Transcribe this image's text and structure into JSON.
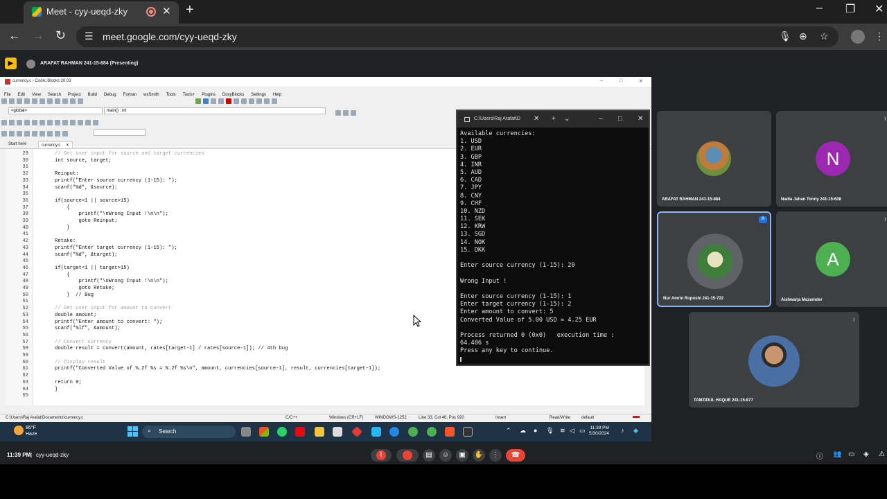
{
  "browser": {
    "tab_title": "Meet - cyy-ueqd-zky",
    "url": "meet.google.com/cyy-ueqd-zky"
  },
  "meet": {
    "presenting_label": "ARAFAT RAHMAN 241-15-884 (Presenting)",
    "meeting_time": "11:39 PM",
    "meeting_code": "cyy-ueqd-zky",
    "participants": [
      {
        "name": "ARAFAT RAHMAN 241-15-884",
        "type": "photo"
      },
      {
        "name": "Nadia Jahan Tonny 241-15-608",
        "type": "initial",
        "initial": "N",
        "color": "#9c27b0"
      },
      {
        "name": "Nur Amrin Ruposhi 241-15-722",
        "type": "photo",
        "active": true
      },
      {
        "name": "Aishwarja Mazumder",
        "type": "initial",
        "initial": "A",
        "color": "#4caf50"
      },
      {
        "name": "TAMZIDUL HAQUE 241-15-877",
        "type": "photo"
      }
    ],
    "accent_color": "#8ab4f8",
    "end_call_color": "#ea4335"
  },
  "codeblocks": {
    "title": "currency.c - Code::Blocks 20.03",
    "menu": [
      "File",
      "Edit",
      "View",
      "Search",
      "Project",
      "Build",
      "Debug",
      "Fortran",
      "wxSmith",
      "Tools",
      "Tools+",
      "Plugins",
      "DoxyBlocks",
      "Settings",
      "Help"
    ],
    "scope_global": "<global>",
    "scope_func": "main() : int",
    "tabs": [
      "Start here",
      "currency.c"
    ],
    "line_numbers": [
      "29",
      "30",
      "31",
      "32",
      "33",
      "34",
      "35",
      "36",
      "37",
      "38",
      "39",
      "40",
      "41",
      "42",
      "43",
      "44",
      "45",
      "46",
      "47",
      "48",
      "49",
      "50",
      "51",
      "52",
      "53",
      "54",
      "55",
      "56",
      "57",
      "58",
      "59",
      "60",
      "61",
      "62",
      "63",
      "64",
      "65"
    ],
    "code_lines": [
      "// Get user input for source and target currencies",
      "int source, target;",
      "",
      "Reinput:",
      "printf(\"Enter source currency (1-15): \");",
      "scanf(\"%d\", &source);",
      "",
      "if(source<1 || source>15)",
      "    {",
      "        printf(\"\\nWrong Input !\\n\\n\");",
      "        goto Reinput;",
      "    }",
      "",
      "Retake:",
      "printf(\"Enter target currency (1-15): \");",
      "scanf(\"%d\", &target);",
      "",
      "if(target<1 || target>15)",
      "    {",
      "        printf(\"\\nWrong Input !\\n\\n\");",
      "        goto Retake;",
      "    }  // Bug",
      "",
      "// Get user input for amount to convert",
      "double amount;",
      "printf(\"Enter amount to convert: \");",
      "scanf(\"%lf\", &amount);",
      "",
      "// Convert currency",
      "double result = convert(amount, rates[target-1] / rates[source-1]); // 4th bug",
      "",
      "// Display result",
      "printf(\"Converted Value of %.2f %s = %.2f %s\\n\", amount, currencies[source-1], result, currencies[target-1]);",
      "",
      "return 0;",
      "}",
      ""
    ],
    "status": {
      "path": "C:\\Users\\Raj Arafat\\Documents\\currency.c",
      "lang": "C/C++",
      "eol": "Windows (CR+LF)",
      "encoding": "WINDOWS-1252",
      "position": "Line 33, Col 46, Pos 920",
      "mode": "Insert",
      "access": "Read/Write",
      "profile": "default"
    }
  },
  "console": {
    "title": "C:\\Users\\Raj Arafat\\D",
    "lines": [
      "Available currencies:",
      "1. USD",
      "2. EUR",
      "3. GBP",
      "4. INR",
      "5. AUD",
      "6. CAD",
      "7. JPY",
      "8. CNY",
      "9. CHF",
      "10. NZD",
      "11. SEK",
      "12. KRW",
      "13. SGD",
      "14. NOK",
      "15. DKK",
      "",
      "Enter source currency (1-15): 20",
      "",
      "Wrong Input !",
      "",
      "Enter source currency (1-15): 1",
      "Enter target currency (1-15): 2",
      "Enter amount to convert: 5",
      "Converted Value of 5.00 USD = 4.25 EUR",
      "",
      "Process returned 0 (0x0)   execution time :",
      "64.486 s",
      "Press any key to continue."
    ]
  },
  "taskbar": {
    "weather_temp": "86°F",
    "weather_desc": "Haze",
    "search_label": "Search",
    "time": "11:39 PM",
    "date": "5/30/2024"
  }
}
